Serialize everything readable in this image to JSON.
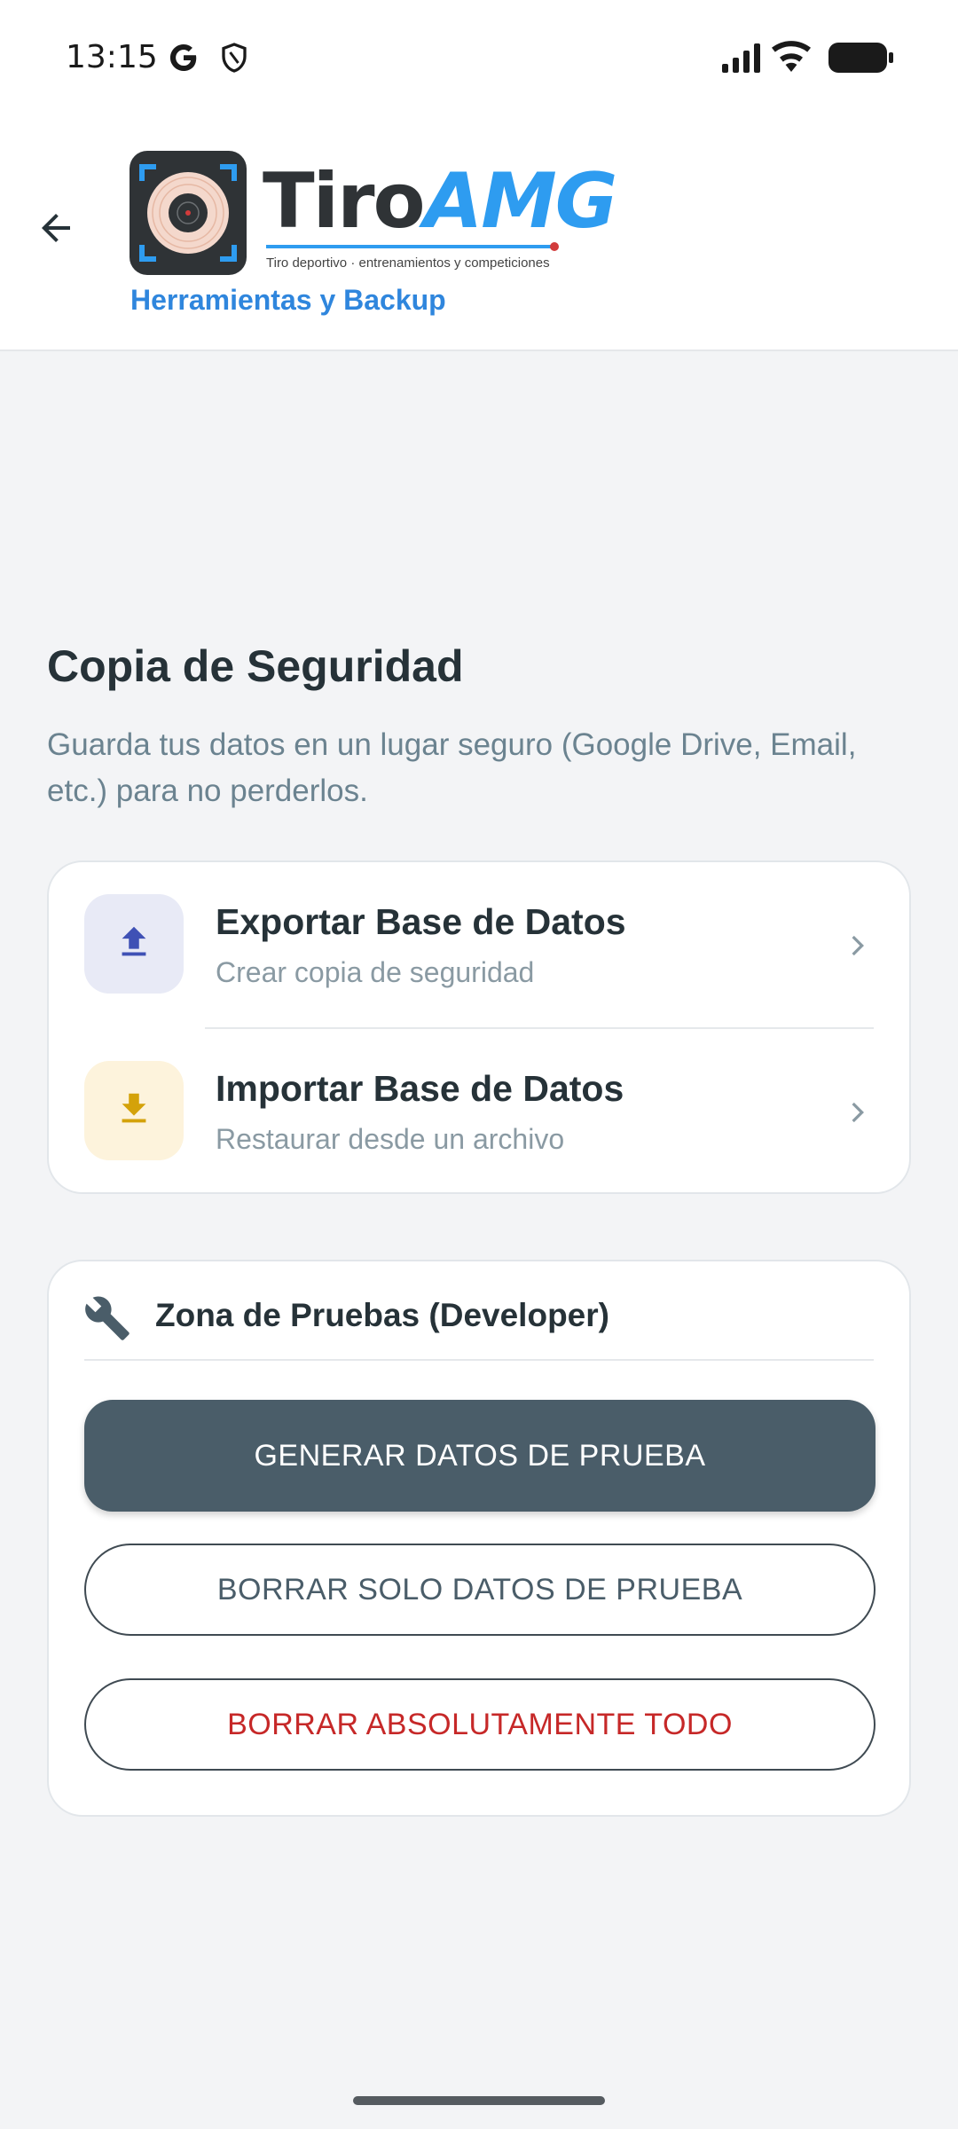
{
  "status_bar": {
    "time": "13:15",
    "left_icons": [
      "google-g-icon",
      "shield-icon"
    ],
    "right_icons": [
      "signal-icon",
      "wifi-icon",
      "battery-icon"
    ]
  },
  "app_bar": {
    "back_icon": "arrow-back-icon",
    "logo": {
      "brand_part1": "Tiro",
      "brand_part2": "AMG",
      "tagline": "Tiro deportivo · entrenamientos y competiciones"
    },
    "subtitle": "Herramientas y Backup"
  },
  "backup": {
    "title": "Copia de Seguridad",
    "description": "Guarda tus datos en un lugar seguro (Google Drive, Email, etc.) para no perderlos.",
    "items": [
      {
        "icon": "upload-icon",
        "title": "Exportar Base de Datos",
        "subtitle": "Crear copia de seguridad",
        "icon_color": "#3f51b5",
        "icon_bg": "#e8eaf6"
      },
      {
        "icon": "download-icon",
        "title": "Importar Base de Datos",
        "subtitle": "Restaurar desde un archivo",
        "icon_color": "#d4a20a",
        "icon_bg": "#fdf3dc"
      }
    ]
  },
  "dev_zone": {
    "icon": "wrench-icon",
    "title": "Zona de Pruebas (Developer)",
    "buttons": {
      "generate": "GENERAR DATOS DE PRUEBA",
      "delete_test": "BORRAR SOLO DATOS DE PRUEBA",
      "delete_all": "BORRAR ABSOLUTAMENTE TODO"
    }
  },
  "colors": {
    "accent_blue": "#2f86dd",
    "primary_button": "#4a5d69",
    "danger": "#c62828",
    "background": "#f3f4f6"
  }
}
